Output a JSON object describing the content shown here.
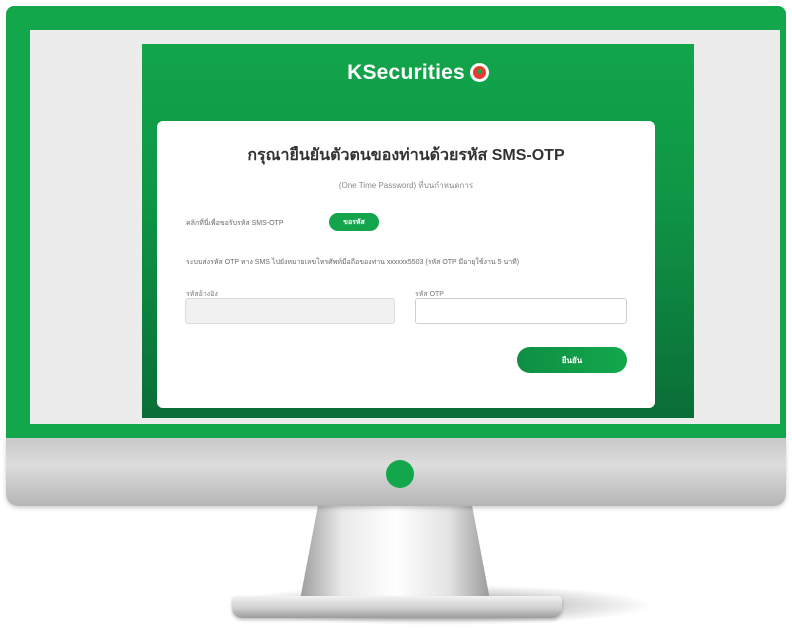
{
  "app": {
    "brand_name": "KSecurities",
    "brand_logo_icon": "kasikorn-leaf-logo-icon",
    "brand_color": "#12a54b",
    "logo_accent_color": "#e63a2f"
  },
  "otp_form": {
    "title": "กรุณายืนยันตัวตนของท่านด้วยรหัส SMS-OTP",
    "subtitle": "(One Time Password) ที่บนกำหนดการ",
    "request_label": "คลิกที่นี่เพื่อขอรับรหัส SMS-OTP",
    "request_button_label": "ขอรหัส",
    "instruction_text": "ระบบส่งรหัส OTP ทาง SMS ไปยังหมายเลขโทรศัพท์มือถือของท่าน xxxxxx5503 (รหัส OTP มีอายุใช้งาน 5 นาที)",
    "ref_label": "รหัสอ้างอิง",
    "ref_value": "",
    "otp_label": "รหัส OTP",
    "otp_value": "",
    "confirm_button_label": "ยืนยัน"
  },
  "monitor": {
    "frame_color": "#12a74b",
    "power_indicator_color": "#12a74b"
  }
}
